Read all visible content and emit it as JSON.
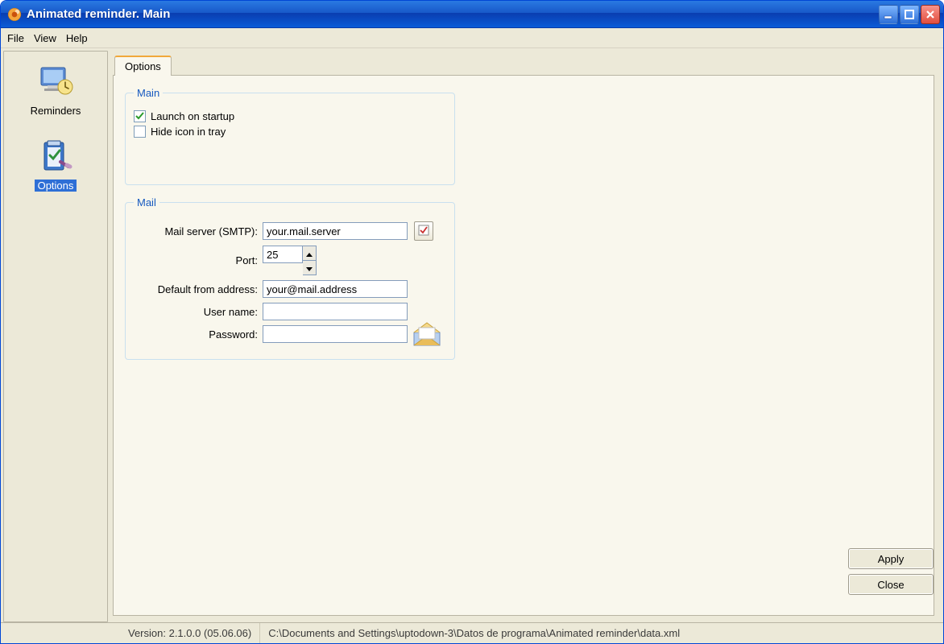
{
  "window": {
    "title": "Animated reminder. Main"
  },
  "menu": {
    "file": "File",
    "view": "View",
    "help": "Help"
  },
  "sidebar": {
    "reminders_label": "Reminders",
    "options_label": "Options"
  },
  "tabs": {
    "options": "Options"
  },
  "groups": {
    "main_legend": "Main",
    "mail_legend": "Mail"
  },
  "options_main": {
    "launch_label": "Launch on startup",
    "hide_label": "Hide icon in tray"
  },
  "mail": {
    "server_label": "Mail server (SMTP):",
    "server_value": "your.mail.server",
    "port_label": "Port:",
    "port_value": "25",
    "from_label": "Default from address:",
    "from_value": "your@mail.address",
    "user_label": "User name:",
    "user_value": "",
    "pass_label": "Password:",
    "pass_value": ""
  },
  "buttons": {
    "apply": "Apply",
    "close": "Close"
  },
  "status": {
    "version": "Version: 2.1.0.0 (05.06.06)",
    "path": "C:\\Documents and Settings\\uptodown-3\\Datos de programa\\Animated reminder\\data.xml"
  }
}
